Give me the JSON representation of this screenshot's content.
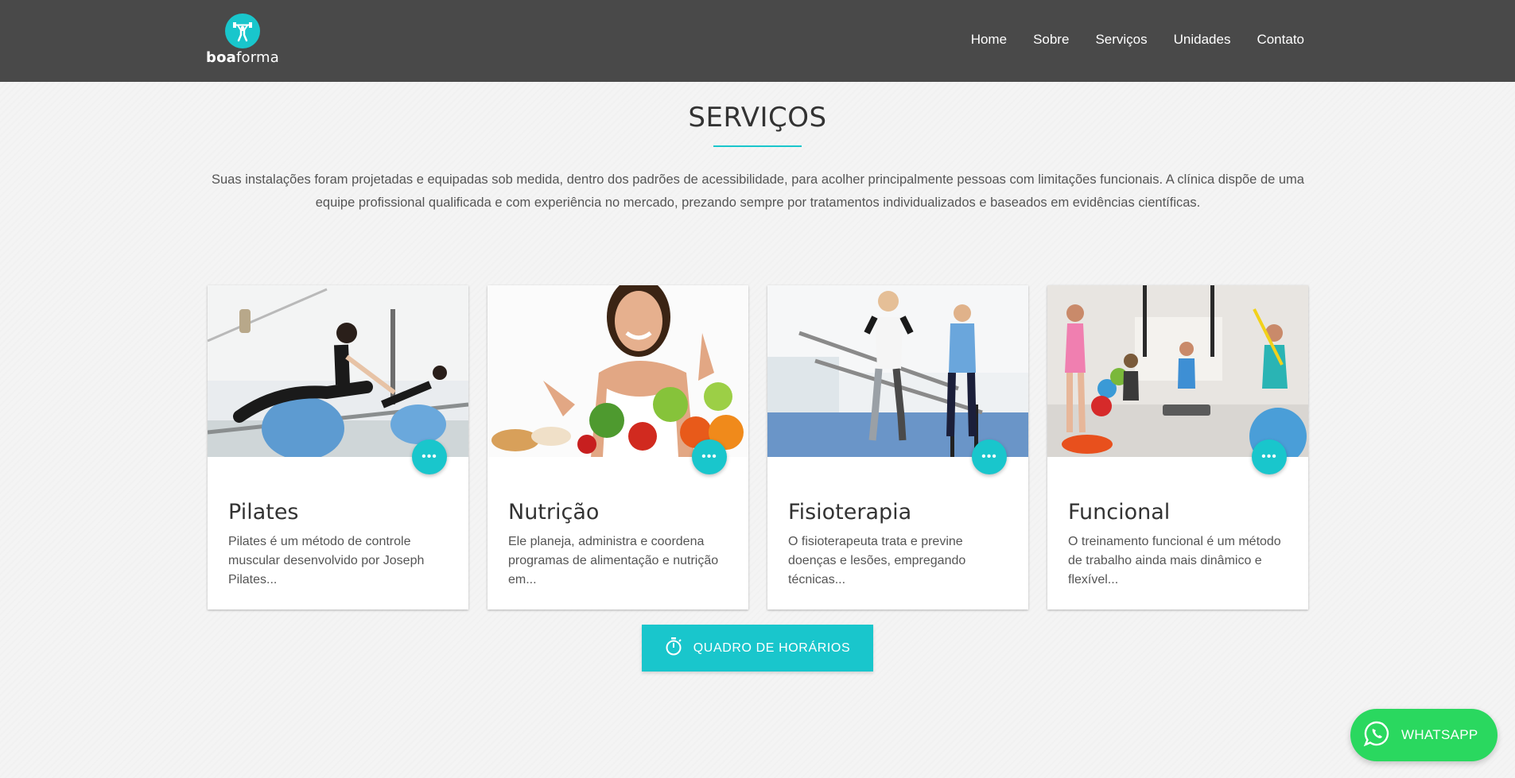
{
  "header": {
    "logo": {
      "text_bold": "boa",
      "text_regular": "forma",
      "icon": "weightlifter-icon"
    },
    "nav": [
      {
        "label": "Home"
      },
      {
        "label": "Sobre"
      },
      {
        "label": "Serviços"
      },
      {
        "label": "Unidades"
      },
      {
        "label": "Contato"
      }
    ]
  },
  "section": {
    "title": "SERVIÇOS",
    "intro_line1": "Suas instalações foram projetadas e equipadas sob medida, dentro dos padrões de acessibilidade, para acolher principalmente pessoas com limitações funcionais. A clínica dispõe de uma",
    "intro_line2": "equipe profissional qualificada e com experiência no mercado, prezando sempre por tratamentos individualizados e baseados em evidências científicas."
  },
  "cards": [
    {
      "title": "Pilates",
      "text": "Pilates é um método de controle muscular desenvolvido por Joseph Pilates...",
      "more_icon": "more-horizontal-icon"
    },
    {
      "title": "Nutrição",
      "text": "Ele planeja, administra e coordena programas de alimentação e nutrição em...",
      "more_icon": "more-horizontal-icon"
    },
    {
      "title": "Fisioterapia",
      "text": "O fisioterapeuta trata e previne doenças e lesões, empregando técnicas...",
      "more_icon": "more-horizontal-icon"
    },
    {
      "title": "Funcional",
      "text": "O treinamento funcional é um método de trabalho ainda mais dinâmico e flexível...",
      "more_icon": "more-horizontal-icon"
    }
  ],
  "schedule_button": {
    "label": "QUADRO DE HORÁRIOS",
    "icon": "stopwatch-icon"
  },
  "whatsapp_button": {
    "label": "WHATSAPP",
    "icon": "whatsapp-icon"
  },
  "colors": {
    "accent": "#19c6cc",
    "header_bg": "#494949",
    "whatsapp": "#2ad85f"
  }
}
